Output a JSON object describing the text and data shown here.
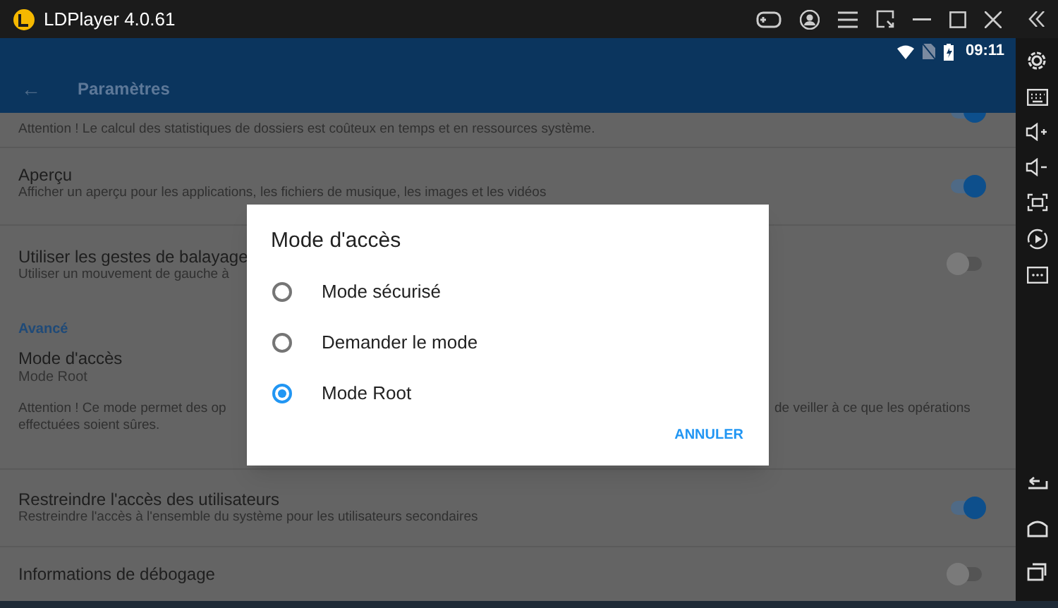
{
  "window": {
    "title": "LDPlayer 4.0.61"
  },
  "status_bar": {
    "time": "09:11"
  },
  "app_bar": {
    "back": "←",
    "title": "Paramètres"
  },
  "settings": [
    {
      "kind": "note",
      "lines": [
        {
          "left": "Attention ! Le calcul des statistiques de dossiers est coûteux en temps et en ressources système."
        }
      ],
      "on": true
    },
    {
      "kind": "toggle",
      "title": "Aperçu",
      "lines": [
        {
          "left": "Afficher un aperçu pour les applications, les fichiers de musique, les images et les vidéos"
        }
      ],
      "on": true
    },
    {
      "kind": "toggle",
      "title": "Utiliser les gestes de balayage",
      "lines": [
        {
          "left": "Utiliser un mouvement de gauche à"
        }
      ],
      "on": false
    },
    {
      "kind": "header",
      "title": "Avancé"
    },
    {
      "kind": "text",
      "title": "Mode d'accès",
      "value": "Mode Root",
      "lines": [
        {
          "left": "Attention ! Ce mode permet des op",
          "right": "de veiller à ce que les opérations"
        },
        {
          "left": "effectuées soient sûres."
        }
      ]
    },
    {
      "kind": "toggle",
      "title": "Restreindre l'accès des utilisateurs",
      "lines": [
        {
          "left": "Restreindre l'accès à l'ensemble du système pour les utilisateurs secondaires"
        }
      ],
      "on": true
    },
    {
      "kind": "toggle",
      "title": "Informations de débogage",
      "on": false
    }
  ],
  "dialog": {
    "title": "Mode d'accès",
    "options": [
      {
        "label": "Mode sécurisé",
        "selected": false
      },
      {
        "label": "Demander le mode",
        "selected": false
      },
      {
        "label": "Mode Root",
        "selected": true
      }
    ],
    "button": "ANNULER"
  }
}
